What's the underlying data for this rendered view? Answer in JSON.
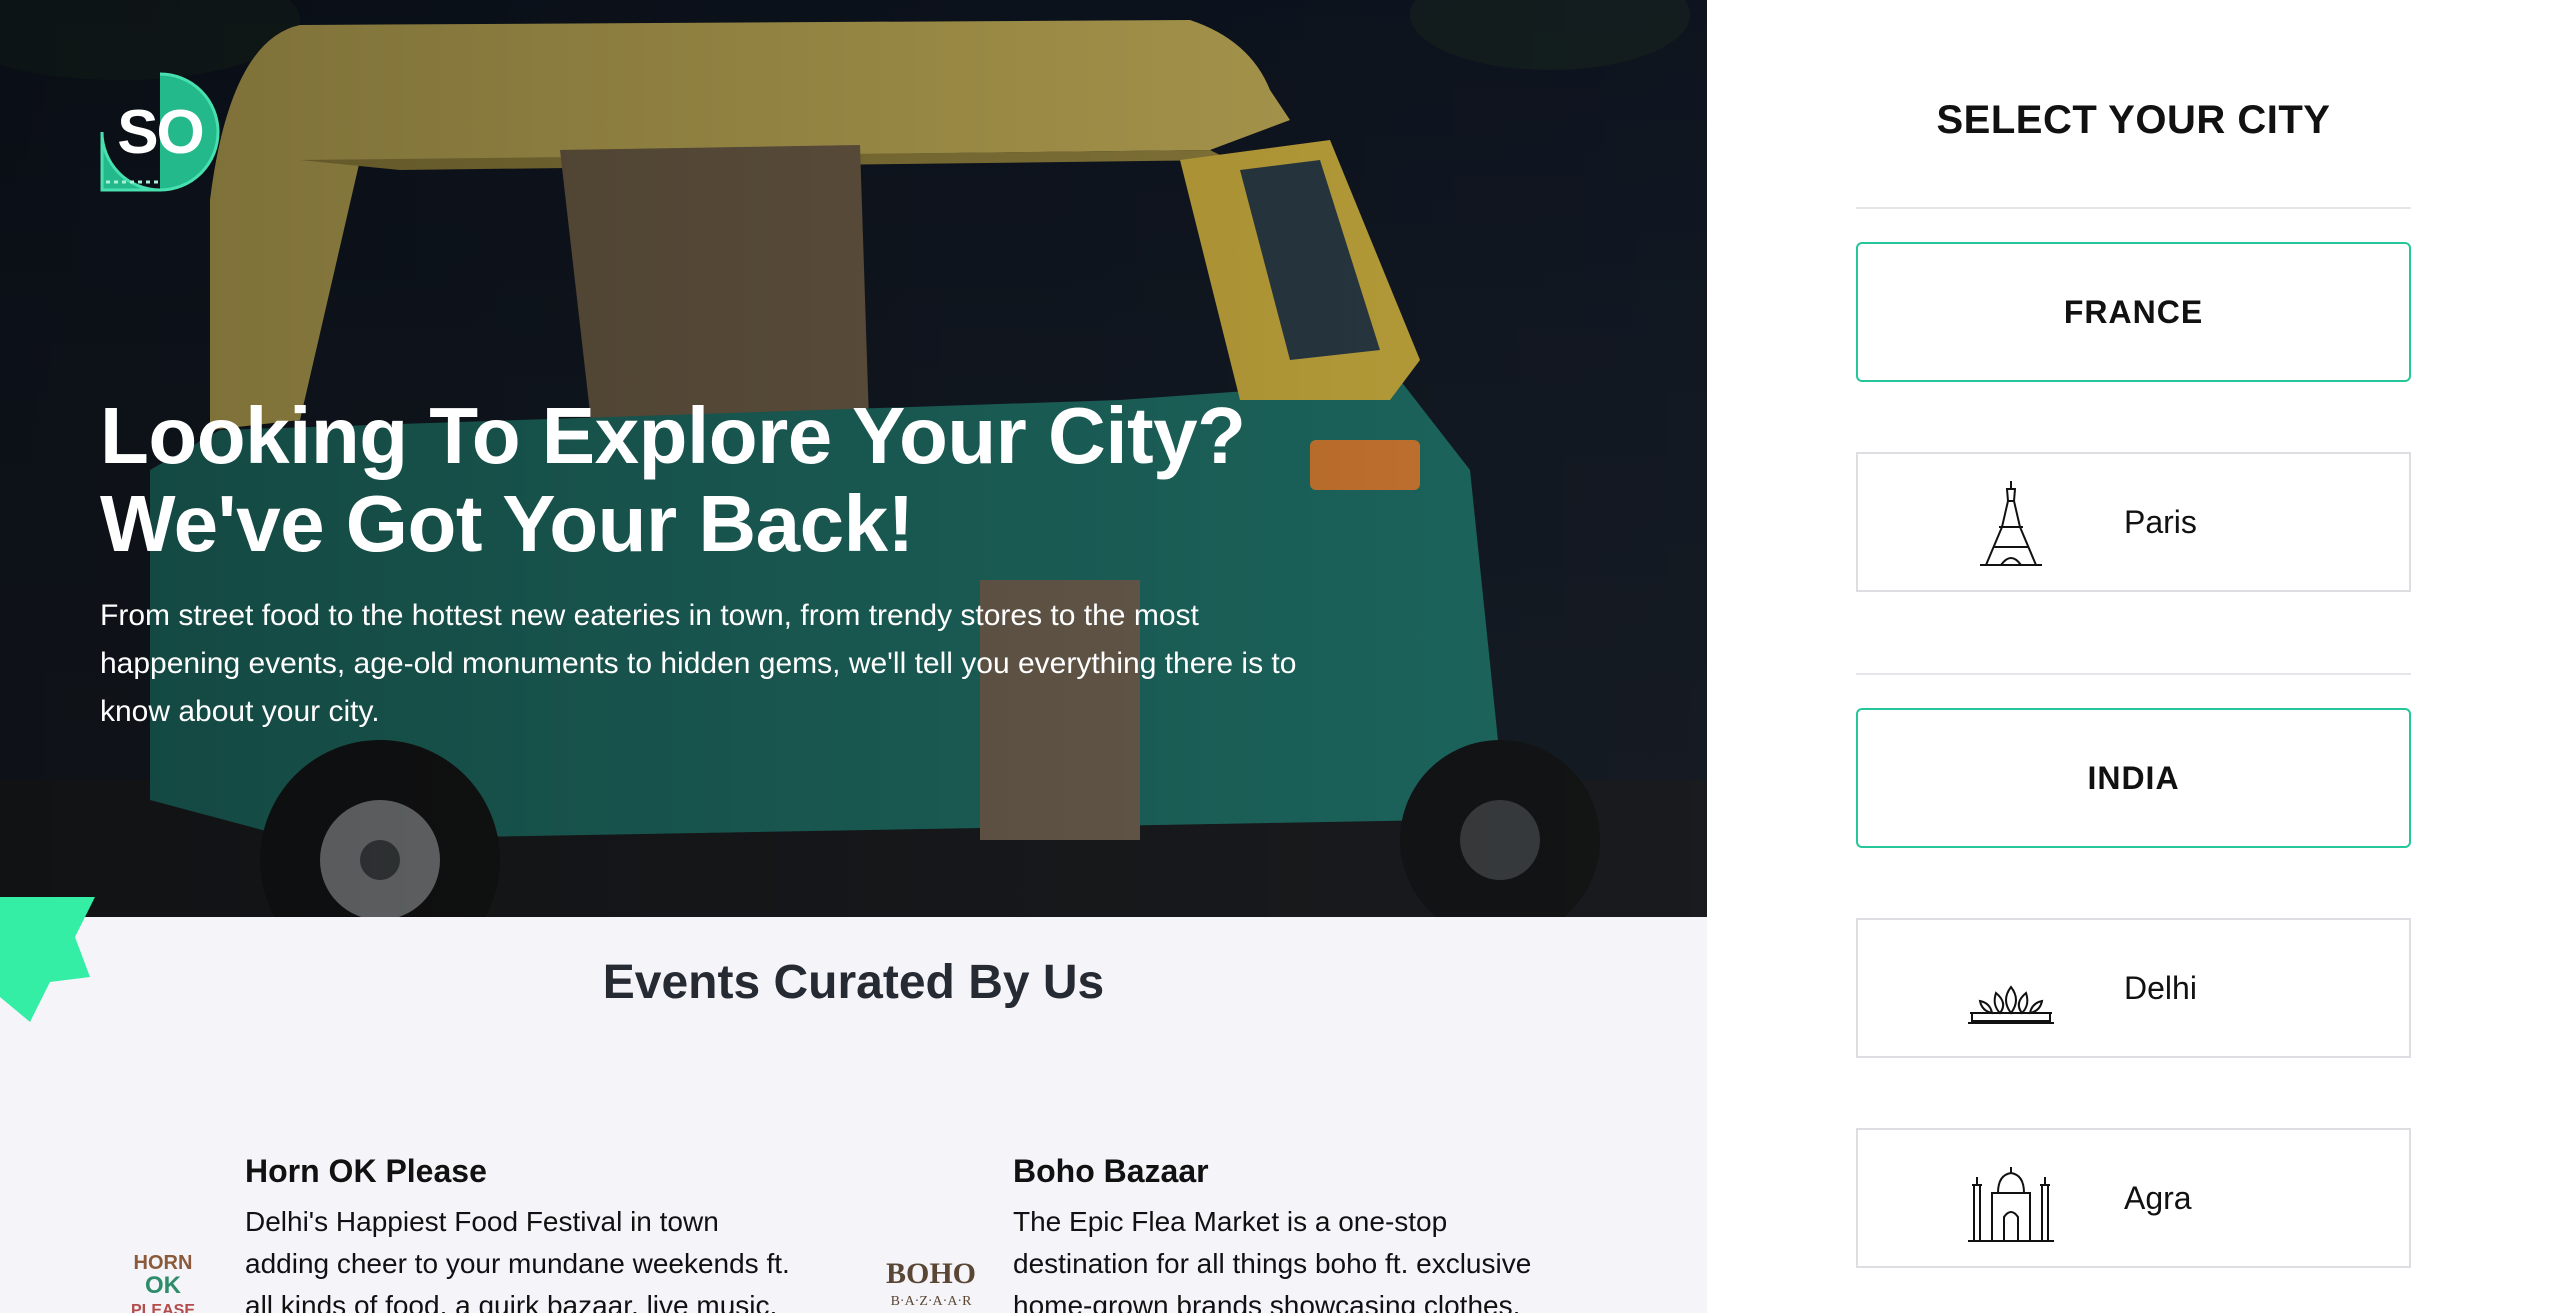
{
  "brand": {
    "logo_text": "SO",
    "accent": "#25c79a"
  },
  "hero": {
    "title_line1": "Looking To Explore Your City?",
    "title_line2": "We've Got Your Back!",
    "description": "From street food to the hottest new eateries in town, from trendy stores to the most happening events, age-old monuments to hidden gems, we'll tell you everything there is to know about your city."
  },
  "events": {
    "title": "Events Curated By Us",
    "items": [
      {
        "title": "Horn OK Please",
        "description": "Delhi's Happiest Food Festival in town adding cheer to your mundane weekends ft. all kinds of food, a quirk bazaar, live music, offbeat",
        "logo_text": "HORN OK PLEASE"
      },
      {
        "title": "Boho Bazaar",
        "description": "The Epic Flea Market is a one-stop destination for all things boho ft. exclusive home-grown brands showcasing clothes, accessories, home",
        "logo_text": "BOHO",
        "logo_subtext": "B·A·Z·A·A·R"
      }
    ]
  },
  "city_selector": {
    "title": "SELECT YOUR CITY",
    "groups": [
      {
        "country": "FRANCE",
        "cities": [
          {
            "name": "Paris",
            "icon": "eiffel-tower-icon"
          }
        ]
      },
      {
        "country": "INDIA",
        "cities": [
          {
            "name": "Delhi",
            "icon": "lotus-temple-icon"
          },
          {
            "name": "Agra",
            "icon": "taj-mahal-icon"
          }
        ]
      }
    ]
  }
}
